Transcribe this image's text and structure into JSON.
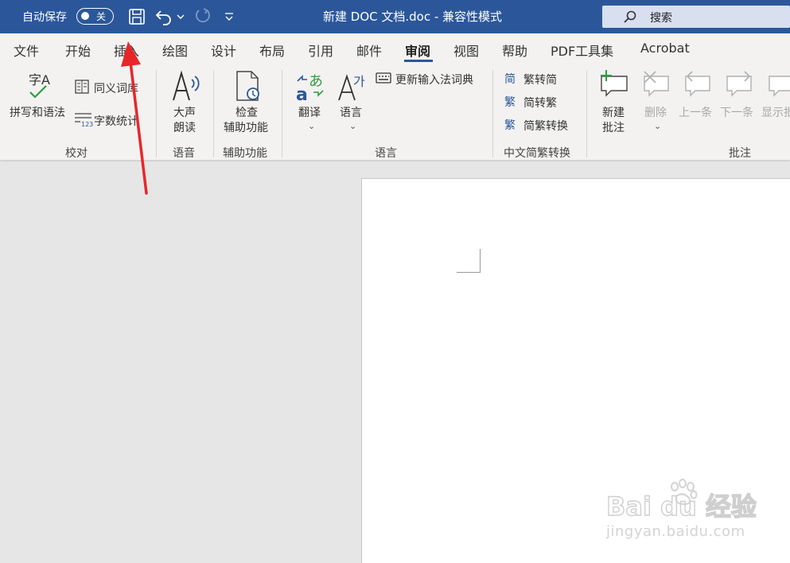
{
  "titlebar": {
    "autosave_label": "自动保存",
    "autosave_state": "关",
    "doc_title": "新建 DOC 文档.doc  -  兼容性模式",
    "search_label": "搜索"
  },
  "menu": {
    "items": [
      "文件",
      "开始",
      "插入",
      "绘图",
      "设计",
      "布局",
      "引用",
      "邮件",
      "审阅",
      "视图",
      "帮助",
      "PDF工具集",
      "Acrobat"
    ],
    "active": "审阅"
  },
  "ribbon": {
    "proofing": {
      "spell_label": "拼写和语法",
      "spell_icon_text": "字A",
      "thesaurus_label": "同义词库",
      "wordcount_label": "字数统计",
      "wordcount_icon_text": "123",
      "group_label": "校对"
    },
    "speech": {
      "read_aloud_line1": "大声",
      "read_aloud_line2": "朗读",
      "group_label": "语音"
    },
    "accessibility": {
      "check_line1": "检查",
      "check_line2": "辅助功能",
      "group_label": "辅助功能"
    },
    "language": {
      "translate_label": "翻译",
      "language_label": "语言",
      "ime_dict_label": "更新输入法词典",
      "group_label": "语言"
    },
    "chinese_conversion": {
      "to_simplified_label": "繁转简",
      "to_traditional_label": "简转繁",
      "convert_label": "简繁转换",
      "icon_glyph_trad": "繁",
      "icon_glyph_simp": "简",
      "group_label": "中文简繁转换"
    },
    "comments": {
      "new_line1": "新建",
      "new_line2": "批注",
      "delete_label": "删除",
      "previous_label": "上一条",
      "next_label": "下一条",
      "show_label": "显示批",
      "group_label": "批注"
    }
  },
  "watermark": {
    "brand": "Bai du 经验",
    "url": "jingyan.baidu.com"
  },
  "colors": {
    "titlebar_bg": "#2b579a",
    "ribbon_bg": "#f3f2f1",
    "annotation_arrow": "#e8262a",
    "accent_green": "#2e9e3e",
    "accent_blue": "#2b579a"
  }
}
